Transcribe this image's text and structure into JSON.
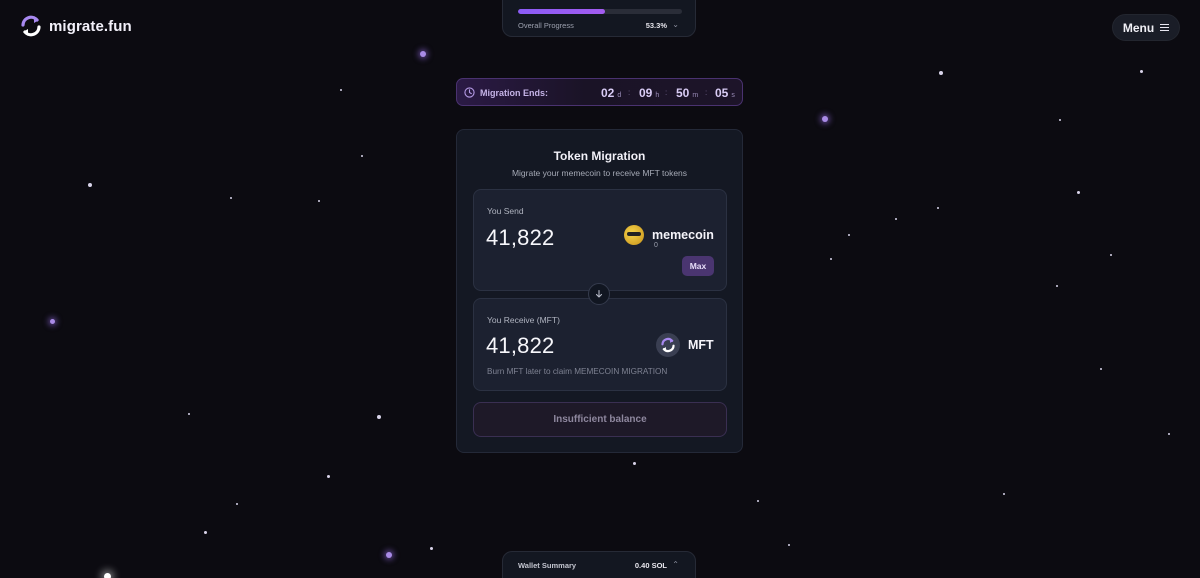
{
  "app": {
    "name": "migrate.fun",
    "logo_icon": "refresh-arrows-icon",
    "accent": "#8b5cf6"
  },
  "header": {
    "menu_label": "Menu",
    "menu_icon": "hamburger-icon"
  },
  "progress": {
    "label": "Overall Progress",
    "value_text": "53.3%",
    "fraction": 0.533,
    "toggle_icon": "chevron-down-icon"
  },
  "countdown": {
    "label": "Migration Ends:",
    "icon": "clock-icon",
    "days": "02",
    "days_suffix": "d",
    "hours": "09",
    "hours_suffix": "h",
    "minutes": "50",
    "minutes_suffix": "m",
    "seconds": "05",
    "seconds_suffix": "s",
    "separator": ":"
  },
  "migration": {
    "title": "Token Migration",
    "subtitle": "Migrate your memecoin to receive MFT tokens",
    "send": {
      "label": "You Send",
      "amount": "41,822",
      "token_name": "memecoin",
      "token_balance": "0",
      "max_label": "Max"
    },
    "swap_icon": "arrow-down-icon",
    "receive": {
      "label": "You Receive (MFT)",
      "amount": "41,822",
      "token_name": "MFT",
      "note": "Burn MFT later to claim MEMECOIN MIGRATION"
    },
    "action_label": "Insufficient balance"
  },
  "wallet": {
    "label": "Wallet Summary",
    "value": "0.40 SOL",
    "toggle_icon": "chevron-up-icon"
  }
}
